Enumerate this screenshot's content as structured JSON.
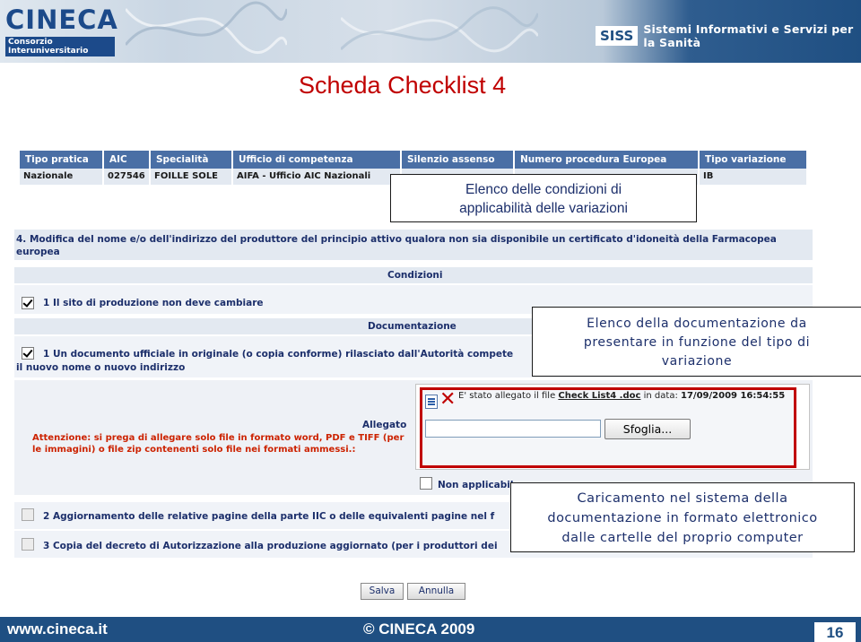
{
  "header": {
    "logo_text": "CINECA",
    "logo_subtitle": "Consorzio Interuniversitario",
    "siss_label": "SISS",
    "siss_tagline": "Sistemi Informativi e Servizi per la Sanità"
  },
  "slide_title": "Scheda Checklist 4",
  "info_table": {
    "headers": [
      "Tipo pratica",
      "AIC",
      "Specialità",
      "Ufficio di competenza",
      "Silenzio assenso",
      "Numero procedura Europea",
      "Tipo variazione"
    ],
    "values": [
      "Nazionale",
      "027546",
      "FOILLE SOLE",
      "AIFA - Ufficio AIC Nazionali",
      "",
      "",
      "IB"
    ]
  },
  "variation": {
    "description": "4. Modifica del nome e/o dell'indirizzo del produttore del principio attivo qualora non sia disponibile un certificato d'idoneità della Farmacopea europea"
  },
  "condizioni": {
    "title": "Condizioni",
    "items": [
      {
        "label": "1  Il sito di produzione non deve cambiare",
        "checked": true
      }
    ]
  },
  "documentazione": {
    "title": "Documentazione",
    "item1_line1": "1  Un documento ufficiale in originale (o copia conforme) rilasciato dall'Autorità compete",
    "item1_line2": "il nuovo nome o nuovo indirizzo",
    "item1_checked": true,
    "allegato_label": "Allegato",
    "warning": "Attenzione: si prega di allegare solo file in formato word, PDF e TIFF (per le immagini) o file zip contenenti solo file nei formati ammessi.:",
    "upload": {
      "attached_prefix": "E' stato allegato il file",
      "file_name": "Check List4 .doc",
      "date_prefix": "in data:",
      "date": "17/09/2009 16:54:55",
      "file_input_value": "",
      "browse_label": "Sfoglia..."
    },
    "not_applicable_label": "Non applicabil",
    "item2": "2  Aggiornamento delle relative pagine della parte IIC o delle equivalenti pagine nel f",
    "item3": "3  Copia del decreto di Autorizzazione alla produzione aggiornato (per i produttori dei"
  },
  "buttons": {
    "save": "Salva",
    "cancel": "Annulla"
  },
  "callouts": {
    "conditions": [
      "Elenco delle condizioni di",
      "applicabilità delle variazioni"
    ],
    "documentation": [
      "Elenco della documentazione da",
      "presentare in funzione del tipo di",
      "variazione"
    ],
    "upload": [
      "Caricamento nel sistema della",
      "documentazione in formato elettronico",
      "dalle cartelle del proprio computer"
    ]
  },
  "footer": {
    "website": "www.cineca.it",
    "copyright": "© CINECA 2009",
    "page_number": "16"
  },
  "colors": {
    "title_red": "#c00000",
    "footer_blue": "#1f4f82",
    "table_header_blue": "#4a6fa5",
    "panel_light": "#e3e9f1",
    "warning_red": "#cc2200"
  }
}
